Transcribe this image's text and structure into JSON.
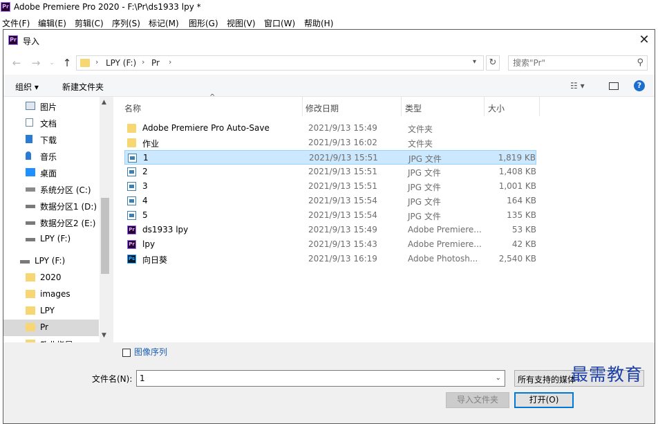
{
  "app": {
    "title": "Adobe Premiere Pro 2020 - F:\\Pr\\ds1933 lpy *",
    "icon": "Pr",
    "menu": [
      "文件(F)",
      "编辑(E)",
      "剪辑(C)",
      "序列(S)",
      "标记(M)",
      "图形(G)",
      "视图(V)",
      "窗口(W)",
      "帮助(H)"
    ]
  },
  "dialog": {
    "title": "导入",
    "address": {
      "crumbs": [
        "LPY (F:)",
        "Pr"
      ]
    },
    "search_placeholder": "搜索\"Pr\"",
    "toolbar": {
      "organize": "组织 ▾",
      "new_folder": "新建文件夹"
    },
    "nav": [
      {
        "label": "图片",
        "icon": "pictures-icon"
      },
      {
        "label": "文档",
        "icon": "documents-icon"
      },
      {
        "label": "下载",
        "icon": "downloads-icon"
      },
      {
        "label": "音乐",
        "icon": "music-icon"
      },
      {
        "label": "桌面",
        "icon": "desktop-icon"
      },
      {
        "label": "系统分区 (C:)",
        "icon": "system-drive-icon"
      },
      {
        "label": "数据分区1 (D:)",
        "icon": "drive-icon"
      },
      {
        "label": "数据分区2 (E:)",
        "icon": "drive-icon"
      },
      {
        "label": "LPY (F:)",
        "icon": "drive-icon"
      },
      {
        "label": "LPY (F:)",
        "icon": "drive-icon"
      },
      {
        "label": "2020",
        "icon": "folder-icon"
      },
      {
        "label": "images",
        "icon": "folder-icon"
      },
      {
        "label": "LPY",
        "icon": "folder-icon"
      },
      {
        "label": "Pr",
        "icon": "folder-icon",
        "selected": true
      },
      {
        "label": "教业指导",
        "icon": "folder-icon"
      }
    ],
    "columns": [
      "名称",
      "修改日期",
      "类型",
      "大小"
    ],
    "files": [
      {
        "name": "Adobe Premiere Pro Auto-Save",
        "date": "2021/9/13 15:49",
        "type": "文件夹",
        "size": "",
        "icon": "folder"
      },
      {
        "name": "作业",
        "date": "2021/9/13 16:02",
        "type": "文件夹",
        "size": "",
        "icon": "folder"
      },
      {
        "name": "1",
        "date": "2021/9/13 15:51",
        "type": "JPG 文件",
        "size": "1,819 KB",
        "icon": "jpg",
        "selected": true
      },
      {
        "name": "2",
        "date": "2021/9/13 15:51",
        "type": "JPG 文件",
        "size": "1,408 KB",
        "icon": "jpg"
      },
      {
        "name": "3",
        "date": "2021/9/13 15:51",
        "type": "JPG 文件",
        "size": "1,001 KB",
        "icon": "jpg"
      },
      {
        "name": "4",
        "date": "2021/9/13 15:54",
        "type": "JPG 文件",
        "size": "164 KB",
        "icon": "jpg"
      },
      {
        "name": "5",
        "date": "2021/9/13 15:54",
        "type": "JPG 文件",
        "size": "135 KB",
        "icon": "jpg"
      },
      {
        "name": "ds1933 lpy",
        "date": "2021/9/13 15:49",
        "type": "Adobe Premiere...",
        "size": "53 KB",
        "icon": "pr"
      },
      {
        "name": "lpy",
        "date": "2021/9/13 15:43",
        "type": "Adobe Premiere...",
        "size": "42 KB",
        "icon": "pr"
      },
      {
        "name": "向日葵",
        "date": "2021/9/13 16:19",
        "type": "Adobe Photosh...",
        "size": "2,540 KB",
        "icon": "ps"
      }
    ],
    "image_sequence_label": "图像序列",
    "filename_label": "文件名(N):",
    "filename_value": "1",
    "filetype_value": "所有支持的媒体",
    "import_folder_label": "导入文件夹",
    "open_label": "打开(O)"
  },
  "watermark": "最需教育"
}
